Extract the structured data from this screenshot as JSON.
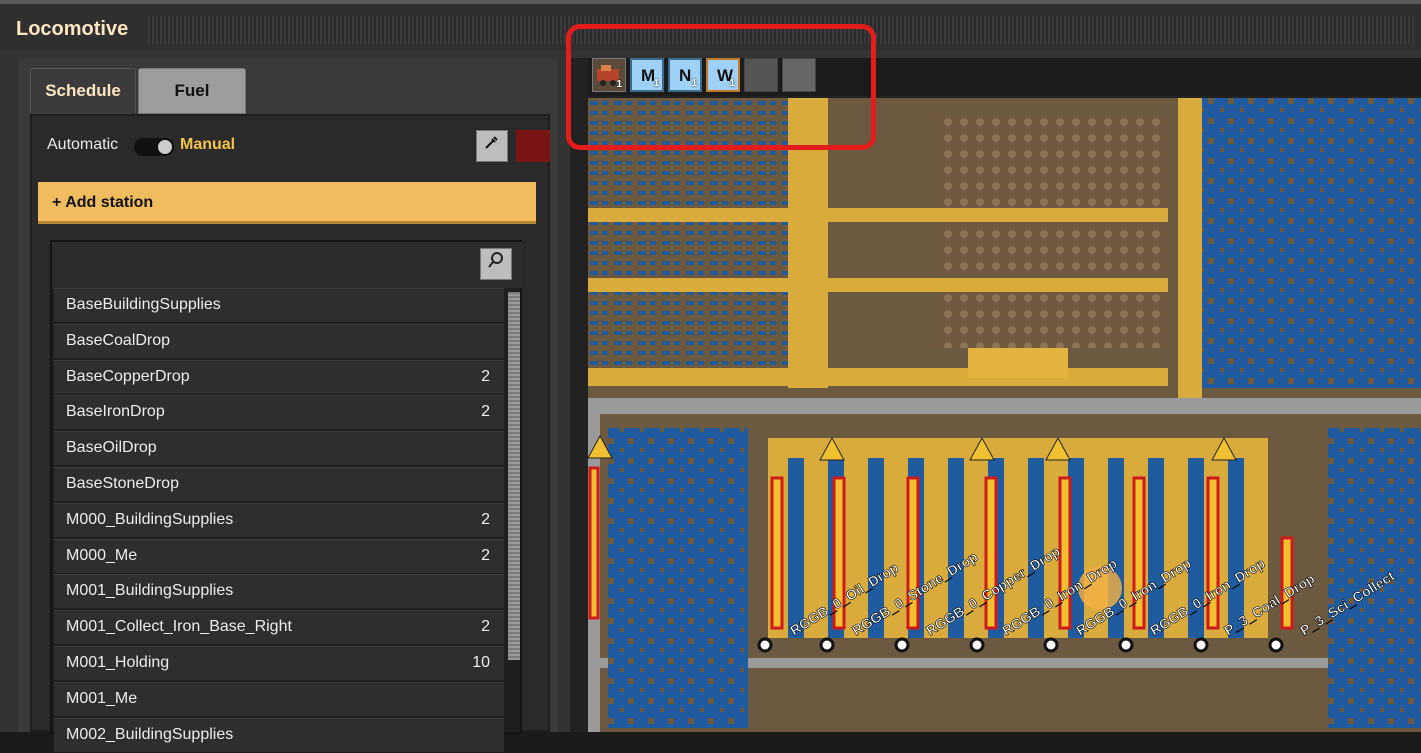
{
  "window": {
    "title": "Locomotive"
  },
  "tabs": [
    {
      "label": "Schedule"
    },
    {
      "label": "Fuel"
    }
  ],
  "mode": {
    "automatic_label": "Automatic",
    "manual_label": "Manual",
    "selected": "Manual"
  },
  "colors": {
    "accent": "#f0bc5e",
    "manual_text": "#f3c14a",
    "swatch": "#7a1515",
    "highlight": "#e41c1c"
  },
  "add_station": {
    "label": "+ Add station"
  },
  "stations": [
    {
      "name": "BaseBuildingSupplies",
      "count": ""
    },
    {
      "name": "BaseCoalDrop",
      "count": ""
    },
    {
      "name": "BaseCopperDrop",
      "count": "2"
    },
    {
      "name": "BaseIronDrop",
      "count": "2"
    },
    {
      "name": "BaseOilDrop",
      "count": ""
    },
    {
      "name": "BaseStoneDrop",
      "count": ""
    },
    {
      "name": "M000_BuildingSupplies",
      "count": "2"
    },
    {
      "name": "M000_Me",
      "count": "2"
    },
    {
      "name": "M001_BuildingSupplies",
      "count": ""
    },
    {
      "name": "M001_Collect_Iron_Base_Right",
      "count": "2"
    },
    {
      "name": "M001_Holding",
      "count": "10"
    },
    {
      "name": "M001_Me",
      "count": ""
    },
    {
      "name": "M002_BuildingSupplies",
      "count": ""
    }
  ],
  "icon_slots": [
    {
      "icon": "locomotive-icon",
      "letter": "",
      "count": "1"
    },
    {
      "icon": "signal-m-icon",
      "letter": "M",
      "count": "1"
    },
    {
      "icon": "signal-n-icon",
      "letter": "N",
      "count": "1"
    },
    {
      "icon": "signal-w-icon",
      "letter": "W",
      "count": "1"
    },
    {
      "icon": "empty-slot",
      "letter": "",
      "count": ""
    },
    {
      "icon": "empty-slot",
      "letter": "",
      "count": ""
    }
  ],
  "map_labels": [
    "RGGB_0_Oil_Drop",
    "RGGB_0_Stone_Drop",
    "RGGB_0_Copper_Drop",
    "RGGB_0_Iron_Drop",
    "RGGB_0_Iron_Drop",
    "RGGB_0_Iron_Drop",
    "P_3_Coal_Drop",
    "P_3_Sci_Collect"
  ]
}
